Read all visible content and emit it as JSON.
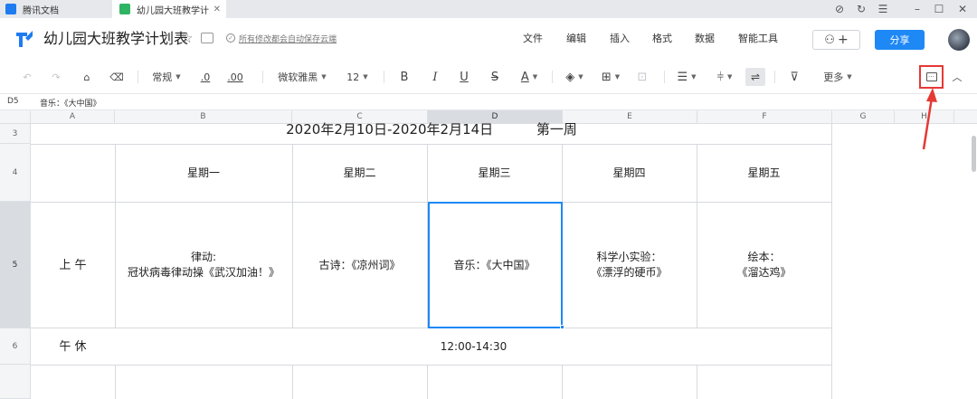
{
  "tabs": [
    {
      "label": "腾讯文档"
    },
    {
      "label": "幼儿园大班教学计"
    }
  ],
  "header": {
    "title": "幼儿园大班教学计划表",
    "save_status": "所有修改都会自动保存云端",
    "menus": [
      "文件",
      "编辑",
      "插入",
      "格式",
      "数据",
      "智能工具"
    ],
    "share_label": "分享",
    "add_collaborator": "+"
  },
  "toolbar": {
    "format": "常规",
    "decimal_dec": ".0",
    "decimal_inc": ".00",
    "font": "微软雅黑",
    "font_size": "12",
    "bold": "B",
    "italic": "I",
    "underline": "U",
    "strike": "S",
    "font_color": "A",
    "more": "更多"
  },
  "formula_bar": {
    "cell_ref": "D5",
    "content": "音乐：《大中国》"
  },
  "grid": {
    "columns": [
      "A",
      "B",
      "C",
      "D",
      "E",
      "F",
      "G",
      "H"
    ],
    "selected_column": "D",
    "rows": [
      "3",
      "4",
      "5",
      "6"
    ],
    "selected_row": "5",
    "title_row": "2020年2月10日-2020年2月14日          第一周",
    "weekdays": [
      "星期一",
      "星期二",
      "星期三",
      "星期四",
      "星期五"
    ],
    "morning_label": "上 午",
    "morning": [
      [
        "律动:",
        "冠状病毒律动操《武汉加油！》"
      ],
      [
        "古诗：《凉州词》"
      ],
      [
        "音乐：《大中国》"
      ],
      [
        "科学小实验：",
        "《漂浮的硬币》"
      ],
      [
        "绘本：",
        "《溜达鸡》"
      ]
    ],
    "nap_label": "午 休",
    "nap_time": "12:00-14:30"
  },
  "colors": {
    "accent": "#1e88f5",
    "annotation": "#e53935"
  }
}
